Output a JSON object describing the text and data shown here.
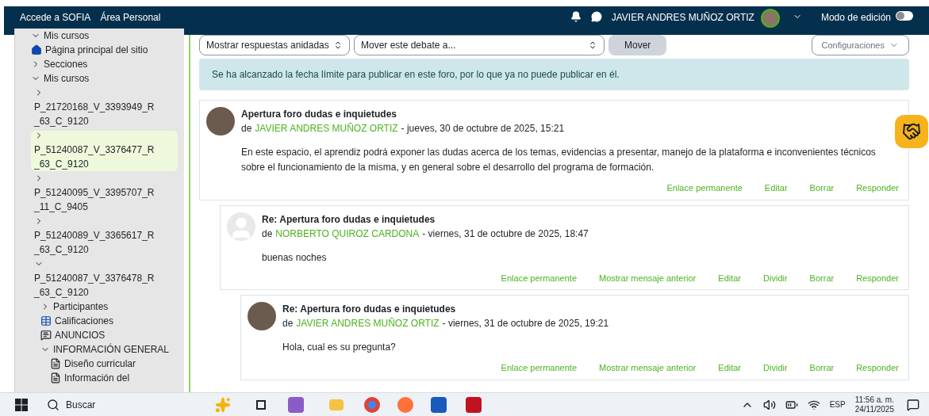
{
  "navbar": {
    "links": [
      "Accede a SOFIA",
      "Área Personal"
    ],
    "user_name": "JAVIER ANDRES MUÑOZ ORTIZ",
    "edit_mode": {
      "label": "Modo de edición",
      "on": false
    }
  },
  "sidebar": {
    "items": [
      {
        "kind": "node",
        "label": "Mis cursos",
        "expanded": true
      },
      {
        "kind": "home",
        "label": "Página principal del sitio"
      },
      {
        "kind": "node",
        "label": "Secciones",
        "expanded": false
      },
      {
        "kind": "node",
        "label": "Mis cursos",
        "expanded": true
      },
      {
        "kind": "course",
        "label": "P_21720168_V_3393949_R_63_C_9120",
        "expanded": false,
        "selected": false
      },
      {
        "kind": "course",
        "label": "P_51240087_V_3376477_R_63_C_9120",
        "expanded": false,
        "selected": true
      },
      {
        "kind": "course",
        "label": "P_51240095_V_3395707_R_11_C_9405",
        "expanded": false,
        "selected": false
      },
      {
        "kind": "course",
        "label": "P_51240089_V_3365617_R_63_C_9120",
        "expanded": false,
        "selected": false
      },
      {
        "kind": "course",
        "label": "P_51240087_V_3376478_R_63_C_9120",
        "expanded": true,
        "selected": false,
        "children": [
          {
            "kind": "node",
            "label": "Participantes",
            "expanded": false
          },
          {
            "kind": "grades",
            "label": "Calificaciones"
          },
          {
            "kind": "forum",
            "label": "ANUNCIOS"
          },
          {
            "kind": "node",
            "label": "INFORMACIÓN GENERAL",
            "expanded": true,
            "children": [
              {
                "kind": "page",
                "label": "Diseño curricular"
              },
              {
                "kind": "page",
                "label": "Información del"
              }
            ]
          }
        ]
      }
    ]
  },
  "toolbar": {
    "display_select": "Mostrar respuestas anidadas",
    "move_select": "Mover este debate a...",
    "move_button": "Mover",
    "settings_button": "Configuraciones"
  },
  "alert": "Se ha alcanzado la fecha límite para publicar en este foro, por lo que ya no puede publicar en él.",
  "posts": [
    {
      "has_photo": true,
      "title": "Apertura foro dudas e inquietudes",
      "by": "de",
      "author": "JAVIER ANDRES MUÑOZ ORTIZ",
      "date": "- jueves, 30 de octubre de 2025, 15:21",
      "body": "En este espacio, el aprendiz podrá exponer las dudas acerca de los temas, evidencias a presentar, manejo de la plataforma e inconvenientes técnicos sobre el funcionamiento de la misma, y en general sobre el desarrollo del programa de formación.",
      "actions": [
        "Enlace permanente",
        "Editar",
        "Borrar",
        "Responder"
      ],
      "children": [
        {
          "has_photo": false,
          "title": "Re: Apertura foro dudas e inquietudes",
          "by": "de",
          "author": "NORBERTO QUIROZ CARDONA",
          "date": "- viernes, 31 de octubre de 2025, 18:47",
          "body": "buenas noches",
          "actions": [
            "Enlace permanente",
            "Mostrar mensaje anterior",
            "Editar",
            "Dividir",
            "Borrar",
            "Responder"
          ],
          "children": [
            {
              "has_photo": true,
              "title": "Re: Apertura foro dudas e inquietudes",
              "by": "de",
              "author": "JAVIER ANDRES MUÑOZ ORTIZ",
              "date": "- viernes, 31 de octubre de 2025, 19:21",
              "body": "Hola, cual es su pregunta?",
              "actions": [
                "Enlace permanente",
                "Mostrar mensaje anterior",
                "Editar",
                "Dividir",
                "Borrar",
                "Responder"
              ]
            }
          ]
        }
      ]
    }
  ],
  "taskbar": {
    "search": "Buscar",
    "language": "ESP",
    "time": "11:56 a. m.",
    "date": "24/11/2025"
  }
}
